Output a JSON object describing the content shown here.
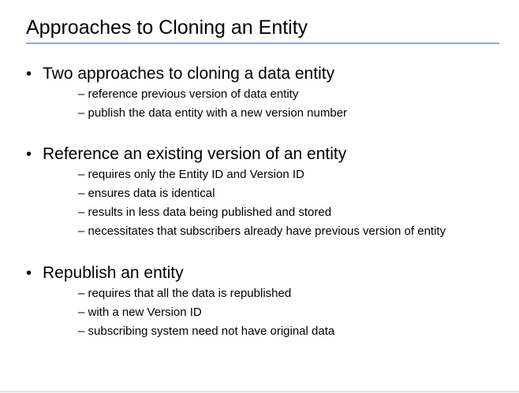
{
  "slide": {
    "title": "Approaches to Cloning an Entity",
    "accent_color": "#8fa9d8",
    "bullet_glyph": "•",
    "sub_glyph": "–",
    "sections": [
      {
        "heading": "Two approaches to cloning a data entity",
        "items": [
          "reference previous version of data entity",
          "publish the data entity with a new version number"
        ]
      },
      {
        "heading": "Reference an existing version of an entity",
        "items": [
          "requires only the Entity ID and Version ID",
          "ensures data is identical",
          "results in less data being published and stored",
          "necessitates that subscribers already have previous version of entity"
        ]
      },
      {
        "heading": "Republish an entity",
        "items": [
          "requires that all the data is republished",
          "with a new Version ID",
          "subscribing system need not have original data"
        ]
      }
    ]
  }
}
